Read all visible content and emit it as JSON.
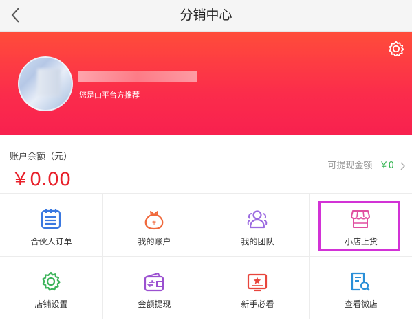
{
  "header": {
    "title": "分销中心",
    "back_icon": "chevron-left-icon"
  },
  "profile": {
    "referrer_text": "您是由平台方推荐",
    "settings_icon": "gear-icon",
    "gradient_colors": [
      "#ff4d3a",
      "#f8214f"
    ]
  },
  "balance": {
    "label": "账户余额（元）",
    "amount": "￥0.00",
    "withdrawable_label": "可提现金额",
    "withdrawable_value": "￥0"
  },
  "menu": [
    {
      "label": "合伙人订单",
      "icon": "order-list-icon",
      "color": "#3a78e0"
    },
    {
      "label": "我的账户",
      "icon": "wallet-bag-icon",
      "color": "#f0693c"
    },
    {
      "label": "我的团队",
      "icon": "team-icon",
      "color": "#9b6ae0"
    },
    {
      "label": "小店上货",
      "icon": "shop-icon",
      "color": "#e04fa0"
    },
    {
      "label": "店铺设置",
      "icon": "settings-gear-icon",
      "color": "#3cb35a"
    },
    {
      "label": "金额提现",
      "icon": "withdraw-wallet-icon",
      "color": "#9b50d0"
    },
    {
      "label": "新手必看",
      "icon": "guide-icon",
      "color": "#e8453c"
    },
    {
      "label": "查看微店",
      "icon": "search-doc-icon",
      "color": "#2a8fd8"
    }
  ],
  "colors": {
    "highlight": "#d232d6",
    "amount": "#e8202a",
    "withdraw_value": "#2cb24b"
  }
}
